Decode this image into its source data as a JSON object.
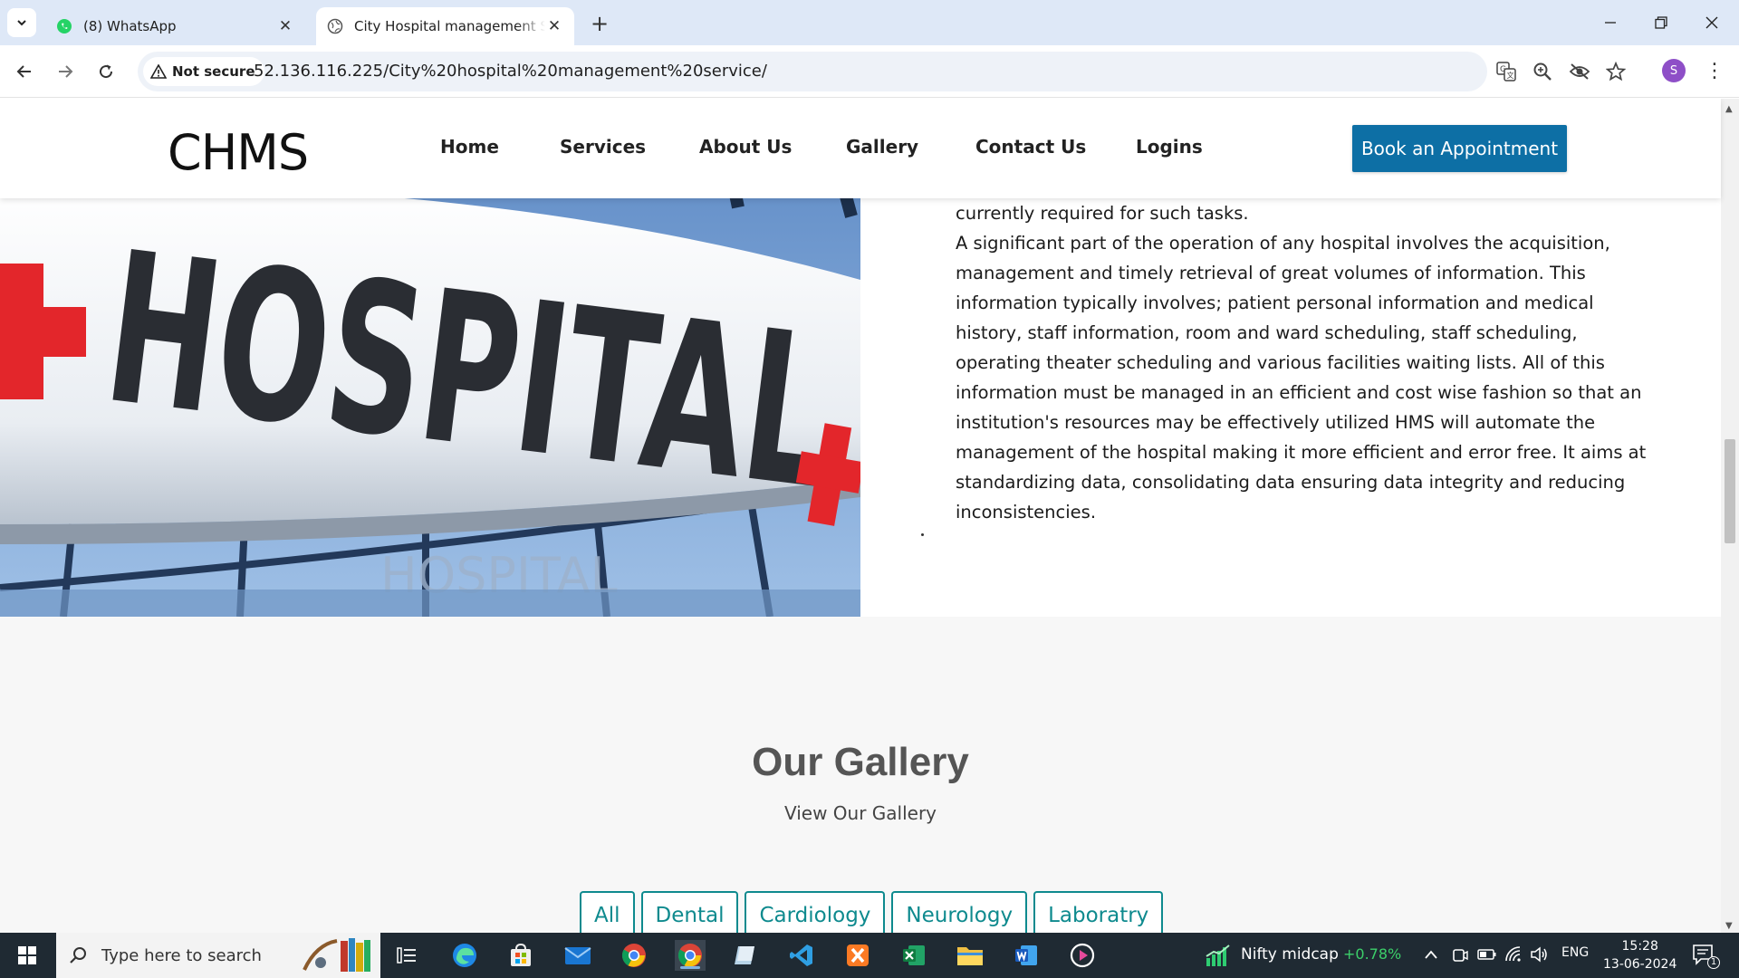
{
  "browser": {
    "tabs": [
      {
        "title": "(8) WhatsApp",
        "active": false
      },
      {
        "title": "City Hospital management Syst",
        "active": true
      }
    ],
    "security_label": "Not secure",
    "url": "52.136.116.225/City%20hospital%20management%20service/",
    "profile_initial": "S"
  },
  "header": {
    "brand": "CHMS",
    "nav": [
      "Home",
      "Services",
      "About Us",
      "Gallery",
      "Contact Us",
      "Logins"
    ],
    "cta": "Book an Appointment"
  },
  "hero_image": {
    "sign_text": "HOSPITAL",
    "reflection_text": "HOSPITAL"
  },
  "about": {
    "paragraph_1_end": "currently required for such tasks.",
    "paragraph_2": "A significant part of the operation of any hospital involves the acquisition, management and timely retrieval of great volumes of information. This information typically involves; patient personal information and medical history, staff information, room and ward scheduling, staff scheduling, operating theater scheduling and various facilities waiting lists. All of this information must be managed in an efficient and cost wise fashion so that an institution's resources may be effectively utilized HMS will automate the management of the hospital making it more efficient and error free. It aims at standardizing data, consolidating data ensuring data integrity and reducing inconsistencies."
  },
  "gallery": {
    "title": "Our Gallery",
    "subtitle": "View Our Gallery",
    "filters": [
      "All",
      "Dental",
      "Cardiology",
      "Neurology",
      "Laboratry"
    ]
  },
  "taskbar": {
    "search_placeholder": "Type here to search",
    "widget_label": "Nifty midcap",
    "widget_delta": "+0.78%",
    "language": "ENG",
    "time": "15:28",
    "date": "13-06-2024",
    "notification_count": "1"
  }
}
